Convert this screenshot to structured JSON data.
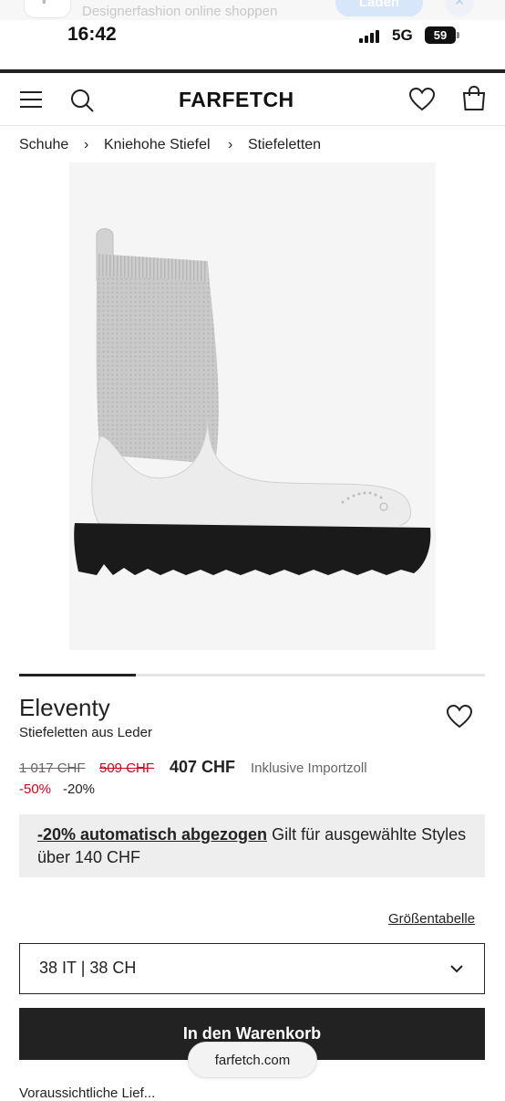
{
  "app_banner": {
    "icon_letters": "F",
    "text": "Designerfashion online shoppen",
    "load_label": "Laden",
    "close_label": "×"
  },
  "status_bar": {
    "time": "16:42",
    "network": "5G",
    "battery": "59"
  },
  "header": {
    "logo": "FARFETCH"
  },
  "breadcrumb": {
    "items": [
      "Schuhe",
      "Kniehohe Stiefel",
      "Stiefeletten"
    ],
    "separator": "›"
  },
  "product": {
    "brand": "Eleventy",
    "description": "Stiefeletten aus Leder",
    "gallery_progress_fraction": 0.25,
    "price_original": "1 017 CHF",
    "price_sale": "509 CHF",
    "price_final": "407 CHF",
    "price_note": "Inklusive Importzoll",
    "discount_sale": "-50%",
    "discount_extra": "-20%"
  },
  "promo": {
    "link_text": "-20% automatisch abgezogen",
    "text": " Gilt für ausgewählte Styles über 140 CHF"
  },
  "size_guide_label": "Größentabelle",
  "size_select": {
    "value": "38 IT | 38 CH"
  },
  "add_to_cart_label": "In den Warenkorb",
  "url_bar": "farfetch.com",
  "cut_text": "Voraussichtliche Lief..."
}
